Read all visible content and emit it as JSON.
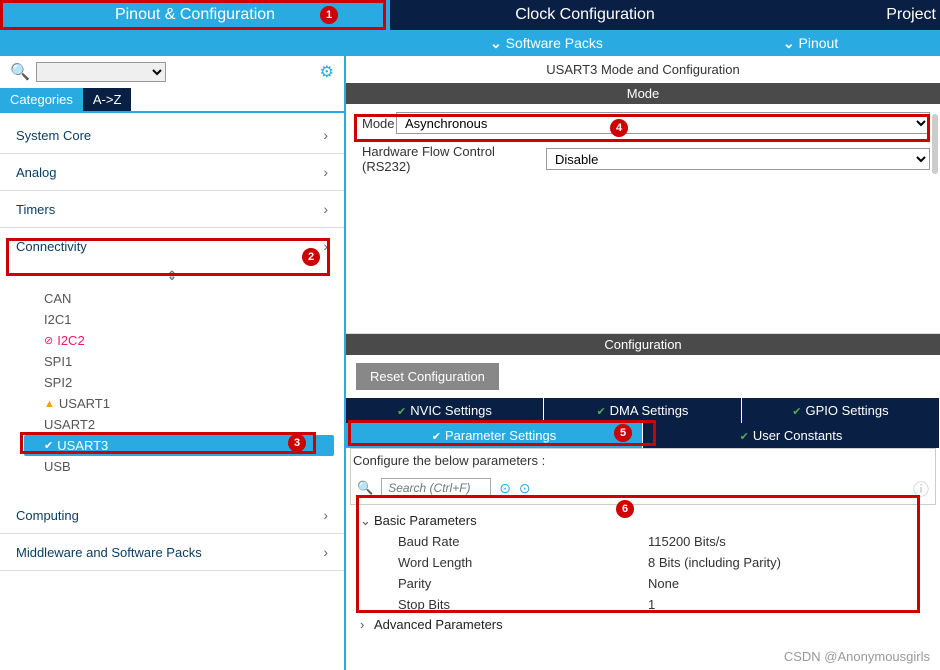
{
  "topNav": {
    "tab1": "Pinout & Configuration",
    "tab2": "Clock Configuration",
    "tab3": "Project"
  },
  "subNav": {
    "item1": "Software Packs",
    "item2": "Pinout"
  },
  "catTabs": {
    "categories": "Categories",
    "az": "A->Z"
  },
  "categories": {
    "systemCore": "System Core",
    "analog": "Analog",
    "timers": "Timers",
    "connectivity": "Connectivity",
    "computing": "Computing",
    "middleware": "Middleware and Software Packs"
  },
  "connectivity": {
    "can": "CAN",
    "i2c1": "I2C1",
    "i2c2": "I2C2",
    "spi1": "SPI1",
    "spi2": "SPI2",
    "usart1": "USART1",
    "usart2": "USART2",
    "usart3": "USART3",
    "usb": "USB"
  },
  "rightTitle": "USART3 Mode and Configuration",
  "sections": {
    "mode": "Mode",
    "config": "Configuration"
  },
  "mode": {
    "modeLabel": "Mode",
    "modeValue": "Asynchronous",
    "flowLabel": "Hardware Flow Control (RS232)",
    "flowValue": "Disable"
  },
  "resetBtn": "Reset Configuration",
  "cfgTabs": {
    "nvic": "NVIC Settings",
    "dma": "DMA Settings",
    "gpio": "GPIO Settings",
    "param": "Parameter Settings",
    "user": "User Constants"
  },
  "cfgLabel": "Configure the below parameters :",
  "searchPlaceholder": "Search (Ctrl+F)",
  "params": {
    "basicHeader": "Basic Parameters",
    "advancedHeader": "Advanced Parameters",
    "baudRate": {
      "name": "Baud Rate",
      "value": "115200 Bits/s"
    },
    "wordLength": {
      "name": "Word Length",
      "value": "8 Bits (including Parity)"
    },
    "parity": {
      "name": "Parity",
      "value": "None"
    },
    "stopBits": {
      "name": "Stop Bits",
      "value": "1"
    }
  },
  "watermark": "CSDN @Anonymousgirls"
}
